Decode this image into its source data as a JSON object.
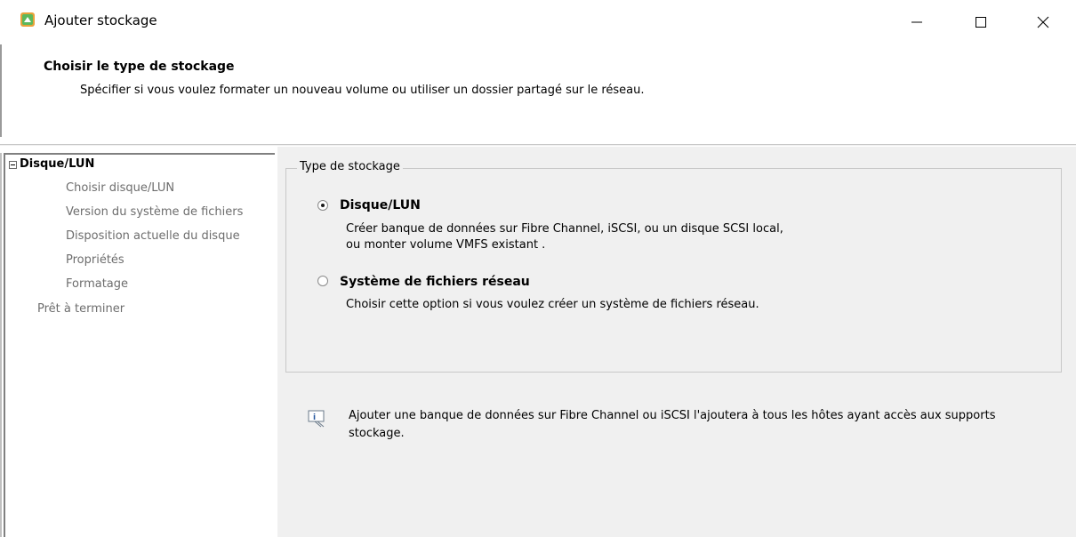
{
  "window": {
    "title": "Ajouter stockage",
    "minimize_glyph": "—",
    "maximize_glyph": "☐",
    "close_glyph": "✕"
  },
  "header": {
    "title": "Choisir le type de stockage",
    "subtitle": "Spécifier si vous voulez formater un nouveau volume ou utiliser un dossier partagé sur le réseau."
  },
  "nav": {
    "items": [
      {
        "label": "Disque/LUN",
        "state": "current"
      },
      {
        "label": "Choisir disque/LUN",
        "state": "sub"
      },
      {
        "label": "Version du système de fichiers",
        "state": "sub"
      },
      {
        "label": "Disposition actuelle du disque",
        "state": "sub"
      },
      {
        "label": "Propriétés",
        "state": "sub"
      },
      {
        "label": "Formatage",
        "state": "sub"
      },
      {
        "label": "Prêt à terminer",
        "state": "pending"
      }
    ]
  },
  "storage_type": {
    "legend": "Type de stockage",
    "options": [
      {
        "label": "Disque/LUN",
        "selected": true,
        "desc_line1": "Créer banque de données sur Fibre Channel, iSCSI, ou un disque SCSI local,",
        "desc_line2": "ou monter volume VMFS existant ."
      },
      {
        "label": "Système de fichiers réseau",
        "selected": false,
        "desc_line1": "Choisir cette option si vous voulez créer un système de fichiers réseau."
      }
    ]
  },
  "info": {
    "icon": "info-icon",
    "text": "Ajouter une banque de données sur Fibre Channel ou iSCSI l'ajoutera à tous les hôtes ayant accès aux supports stockage."
  },
  "colors": {
    "content_bg": "#f0f0f0",
    "disabled_text": "#6d6d6d",
    "app_icon_orange": "#e8a23a",
    "app_icon_green": "#4caf50"
  }
}
